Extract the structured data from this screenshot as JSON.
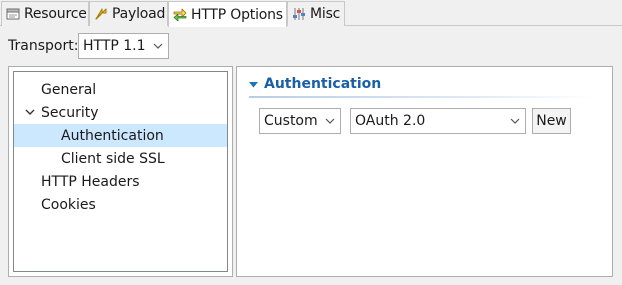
{
  "tabs": [
    {
      "label": "Resource",
      "icon": "resource-icon",
      "active": false
    },
    {
      "label": "Payload",
      "icon": "payload-icon",
      "active": false
    },
    {
      "label": "HTTP Options",
      "icon": "http-options-icon",
      "active": true
    },
    {
      "label": "Misc",
      "icon": "misc-icon",
      "active": false
    }
  ],
  "transport": {
    "label": "Transport:",
    "value": "HTTP 1.1"
  },
  "tree": {
    "items": [
      {
        "label": "General"
      },
      {
        "label": "Security",
        "expanded": true
      },
      {
        "label": "Authentication",
        "selected": true
      },
      {
        "label": "Client side SSL"
      },
      {
        "label": "HTTP Headers"
      },
      {
        "label": "Cookies"
      }
    ]
  },
  "section": {
    "title": "Authentication",
    "auth_type": "Custom",
    "auth_method": "OAuth 2.0",
    "new_button": "New"
  },
  "colors": {
    "section_title": "#1a60a8",
    "selection": "#cce8ff",
    "accent": "#1e73be"
  }
}
